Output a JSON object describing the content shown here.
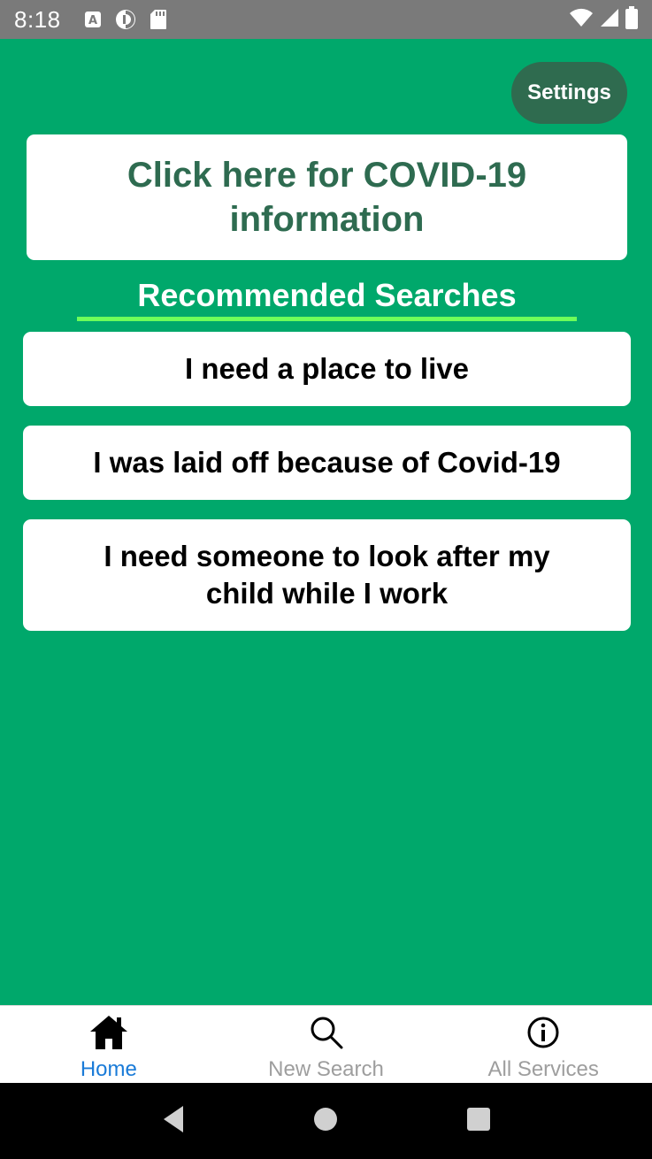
{
  "status_bar": {
    "time": "8:18",
    "icons_left": [
      "a-notification-icon",
      "data-saver-icon",
      "sd-card-icon"
    ],
    "icons_right": [
      "wifi-icon",
      "signal-icon",
      "battery-icon"
    ]
  },
  "header": {
    "settings_label": "Settings"
  },
  "covid_banner": {
    "label": "Click here for COVID-19 information"
  },
  "recommended": {
    "title": "Recommended Searches",
    "items": [
      {
        "label": "I need a place to live"
      },
      {
        "label": "I was laid off because of Covid-19"
      },
      {
        "label": "I need someone to look after my child while I work"
      }
    ]
  },
  "tabs": [
    {
      "label": "Home",
      "icon": "home-icon",
      "active": true
    },
    {
      "label": "New Search",
      "icon": "search-icon",
      "active": false
    },
    {
      "label": "All Services",
      "icon": "info-icon",
      "active": false
    }
  ],
  "colors": {
    "background": "#00a86b",
    "settings_button": "#2f6b4f",
    "covid_text": "#2e6b50",
    "underline": "#6dff5a",
    "tab_active": "#1a7bd8",
    "tab_inactive": "#9e9e9e"
  },
  "system_nav": [
    "back-icon",
    "home-circle-icon",
    "recents-icon"
  ]
}
